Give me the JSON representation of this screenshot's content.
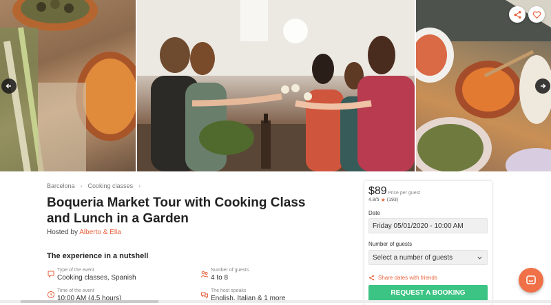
{
  "gallery": {
    "photos": [
      "food-spread-photo",
      "toasting-group-photo",
      "tapas-table-photo"
    ]
  },
  "breadcrumb": {
    "items": [
      "Barcelona",
      "Cooking classes"
    ]
  },
  "experience": {
    "title": "Boqueria Market Tour with Cooking Class and Lunch in a Garden",
    "hosted_prefix": "Hosted by",
    "host_name": "Alberto & Ella",
    "section_title": "The experience in a nutshell",
    "facts": [
      {
        "label": "Type of the event",
        "value": "Cooking classes, Spanish",
        "icon": "chat-bubble-icon"
      },
      {
        "label": "Number of guests",
        "value": "4 to 8",
        "icon": "people-icon"
      },
      {
        "label": "Time of the event",
        "value": "10:00 AM (4.5 hours)",
        "icon": "clock-icon"
      },
      {
        "label": "The host speaks",
        "value": "English, Italian & 1 more",
        "icon": "speech-icon"
      }
    ]
  },
  "booking": {
    "price": "$89",
    "price_label": "Price per guest",
    "rating": "4.8/5",
    "reviews": "(193)",
    "date_label": "Date",
    "date_value": "Friday 05/01/2020 - 10:00 AM",
    "guests_label": "Number of guests",
    "guests_placeholder": "Select a number of guests",
    "share_dates": "Share dates with friends",
    "cta": "REQUEST A BOOKING"
  },
  "colors": {
    "accent": "#e8623c",
    "cta": "#3bc483",
    "chat": "#f07148"
  }
}
